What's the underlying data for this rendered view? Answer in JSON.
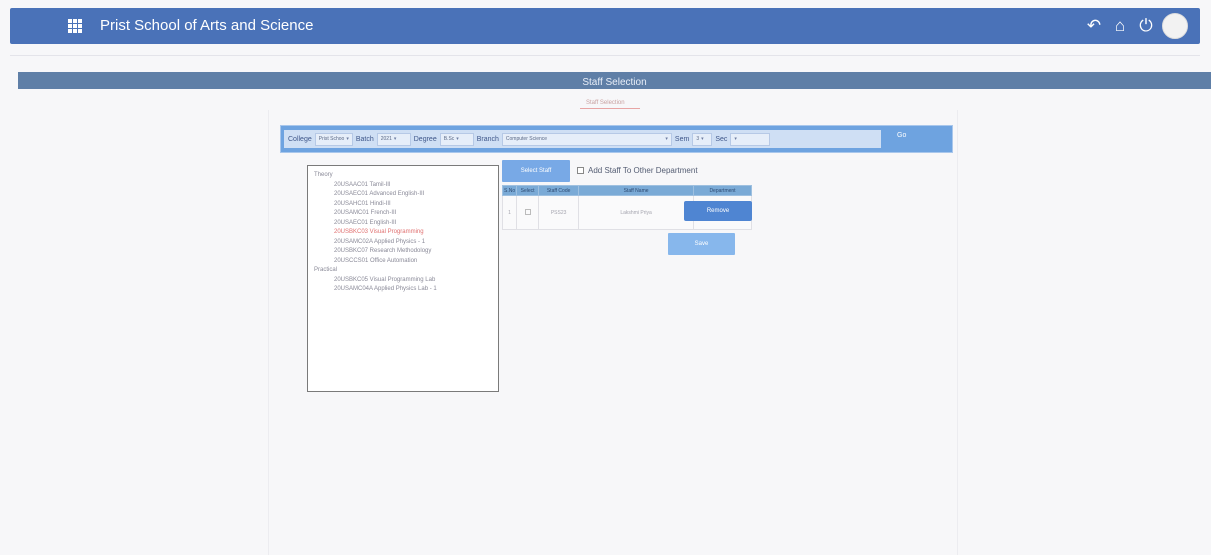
{
  "header": {
    "title": "Prist School of Arts and Science"
  },
  "section": {
    "title": "Staff Selection",
    "subtitle": "Staff Selection"
  },
  "filters": {
    "college_label": "College",
    "college_value": "Prist Schoo",
    "batch_label": "Batch",
    "batch_value": "2021",
    "degree_label": "Degree",
    "degree_value": "B.Sc",
    "branch_label": "Branch",
    "branch_value": "Computer Science",
    "sem_label": "Sem",
    "sem_value": "3",
    "sec_label": "Sec",
    "go_label": "Go"
  },
  "tree": {
    "groups": [
      {
        "label": "Theory",
        "items": [
          "20USAAC01 Tamil-III",
          "20USAEC01 Advanced English-III",
          "20USAHC01 Hindi-III",
          "20USAMC01 French-III",
          "20USAEC01 English-III",
          "20USBKC03 Visual Programming",
          "20USAMC02A Applied Physics - 1",
          "20USBKC07 Research Methodology",
          "20USCCS01 Office Automation"
        ],
        "selected_index": 5
      },
      {
        "label": "Practical",
        "items": [
          "20USBKC05 Visual Programming Lab",
          "20USAMC04A Applied Physics Lab - 1"
        ]
      }
    ]
  },
  "actions": {
    "select_staff": "Select Staff",
    "add_staff_other_dept": "Add Staff To Other Department",
    "remove": "Remove",
    "save": "Save"
  },
  "table": {
    "headers": [
      "S.No",
      "Select",
      "Staff Code",
      "Staff Name",
      "Department"
    ],
    "rows": [
      {
        "sno": "1",
        "code": "PSS23",
        "name": "Lakshmi Priya"
      }
    ]
  }
}
